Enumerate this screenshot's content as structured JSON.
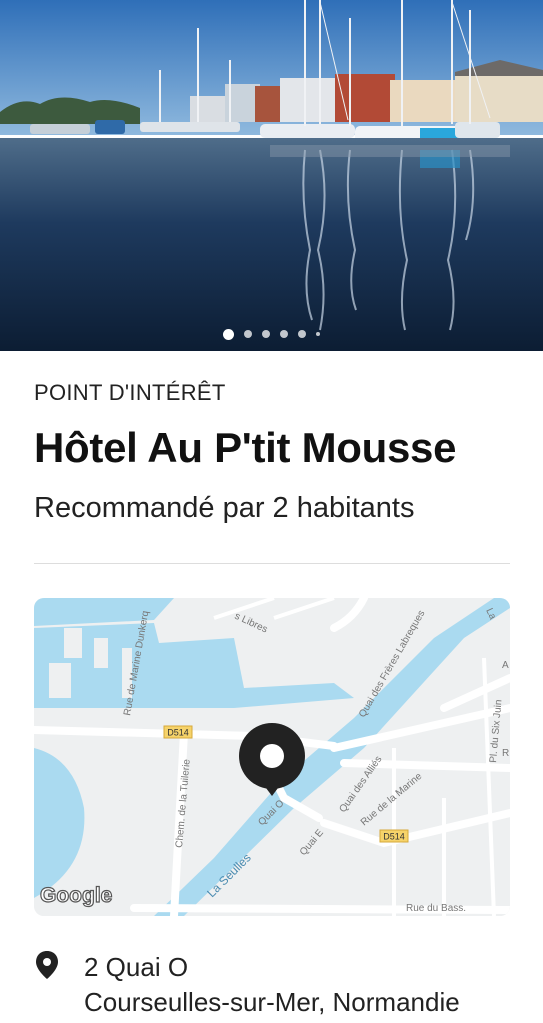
{
  "hero": {
    "image": "marina-harbor-photo",
    "carousel": {
      "count": 6,
      "active_index": 0
    }
  },
  "place": {
    "category": "POINT D'INTÉRÊT",
    "name": "Hôtel Au P'tit Mousse",
    "recommendation": "Recommandé par 2 habitants"
  },
  "map": {
    "logo": "Google",
    "road_badges": [
      "D514",
      "D514"
    ],
    "labels": {
      "libres": "s Libres",
      "marine_dunkerque": "Rue de Marine Dunkerq",
      "freres_labreques": "Quai des Frères Labreques",
      "la": "La",
      "tuilerie": "Chem. de la Tuilerie",
      "quai_o": "Quai O",
      "quai_allies": "Quai des Alliés",
      "rue_marine": "Rue de la Marine",
      "six_juin": "Pl. du Six Juin",
      "quai_e": "Quai E",
      "la_seulles": "La Seulles",
      "rue_bass": "Rue du Bass.",
      "r": "R",
      "a": "A"
    },
    "pin_icon": "map-pin-icon"
  },
  "address": {
    "icon": "location-pin-icon",
    "line1": "2 Quai O",
    "line2": "Courseulles-sur-Mer, Normandie"
  },
  "colors": {
    "water": "#aadaf0",
    "land": "#eef0f1",
    "pin": "#222222"
  }
}
